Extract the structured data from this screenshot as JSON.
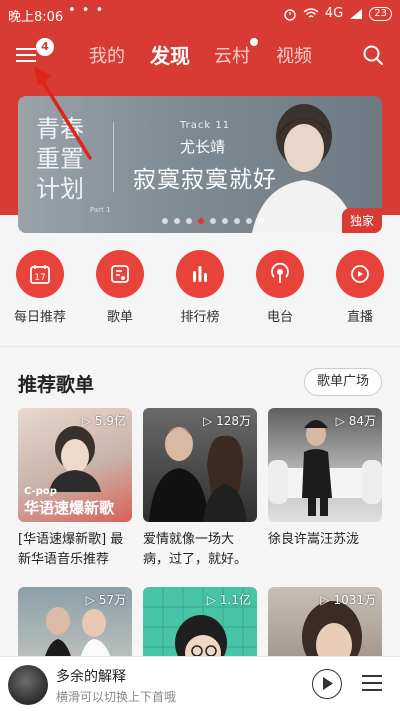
{
  "status": {
    "time": "晚上8:06",
    "network": "4G",
    "battery": "23"
  },
  "nav": {
    "badge": "4",
    "tabs": [
      "我的",
      "发现",
      "云村",
      "视频"
    ],
    "active_tab": "发现"
  },
  "banner": {
    "title_lines": [
      "青春",
      "重置",
      "计划"
    ],
    "part": "Part 1",
    "track": "Track 11",
    "artist": "尤长靖",
    "song": "寂寞寂寞就好",
    "tag": "独家"
  },
  "quick": [
    {
      "label": "每日推荐",
      "icon": "calendar-icon",
      "text": "17"
    },
    {
      "label": "歌单",
      "icon": "playlist-icon"
    },
    {
      "label": "排行榜",
      "icon": "chart-bars-icon"
    },
    {
      "label": "电台",
      "icon": "radio-icon"
    },
    {
      "label": "直播",
      "icon": "live-icon"
    }
  ],
  "section": {
    "title": "推荐歌单",
    "plaza": "歌单广场"
  },
  "playlists": [
    {
      "count": "5.9亿",
      "title": "[华语速爆新歌] 最新华语音乐推荐",
      "cover_pop": "C-pop",
      "cover_text": "华语速爆新歌"
    },
    {
      "count": "128万",
      "title": "爱情就像一场大病，过了，就好。"
    },
    {
      "count": "84万",
      "title": "徐良许嵩汪苏泷"
    },
    {
      "count": "57万"
    },
    {
      "count": "1.1亿"
    },
    {
      "count": "1031万"
    }
  ],
  "player": {
    "title": "多余的解释",
    "hint": "横滑可以切换上下首哦"
  },
  "colors": {
    "brand": "#d83b33",
    "icon_bg": "#e8433a"
  }
}
